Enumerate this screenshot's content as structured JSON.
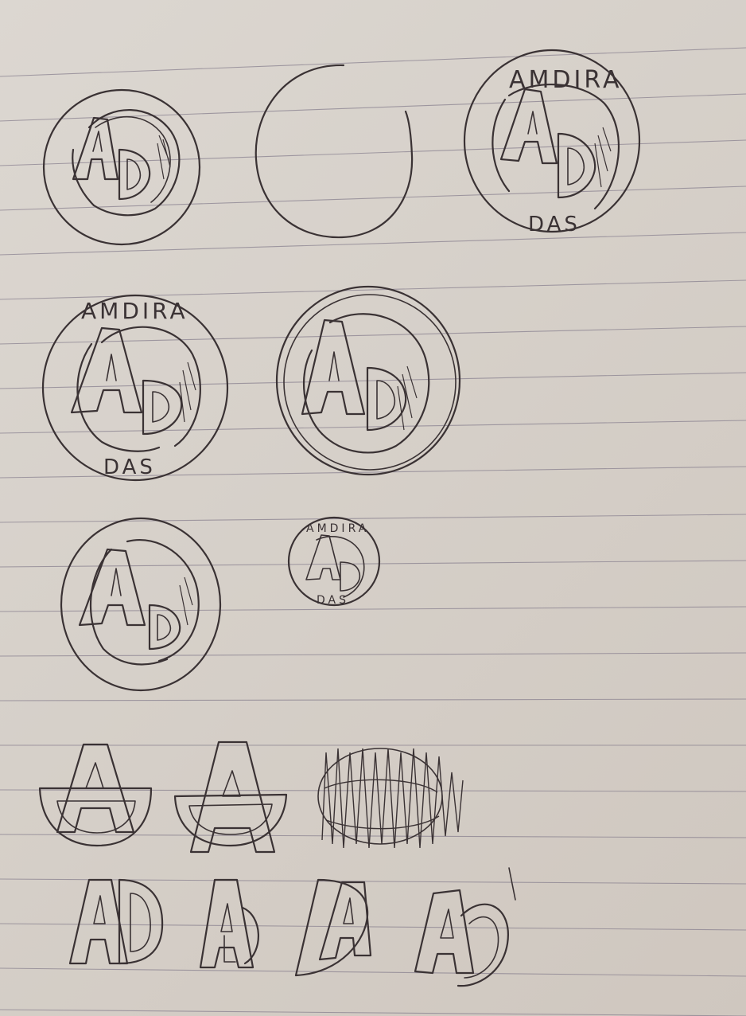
{
  "image": {
    "subject": "hand-drawn AD monogram logo sketches",
    "paper": "lined notebook paper",
    "colors": {
      "paper": "#d6d0c9",
      "ink": "#3a3234",
      "rule_line": "#8a8290"
    }
  },
  "handwriting": {
    "top_right_name": "AMDIRA",
    "top_right_surname": "DAS",
    "middle_left_name": "AMDIRA",
    "middle_left_surname": "DAS",
    "small_name": "AMDIRA",
    "small_surname": "DAS"
  },
  "sketches": [
    {
      "id": "circle-ad-1",
      "letters": "AD"
    },
    {
      "id": "empty-circle",
      "letters": ""
    },
    {
      "id": "circle-ad-name-1",
      "letters": "AD"
    },
    {
      "id": "circle-ad-name-2",
      "letters": "AD"
    },
    {
      "id": "circle-ad-double-ring",
      "letters": "AD"
    },
    {
      "id": "circle-ad-2",
      "letters": "AD"
    },
    {
      "id": "circle-ad-small",
      "letters": "AD"
    },
    {
      "id": "a-bowl-1",
      "letters": "A"
    },
    {
      "id": "a-bowl-2",
      "letters": "A"
    },
    {
      "id": "scribbled-out",
      "letters": ""
    },
    {
      "id": "ad-plain",
      "letters": "AD"
    },
    {
      "id": "a-with-d",
      "letters": "AD"
    },
    {
      "id": "d-a-overlap",
      "letters": "DA"
    },
    {
      "id": "a-d-curve",
      "letters": "AD"
    }
  ]
}
